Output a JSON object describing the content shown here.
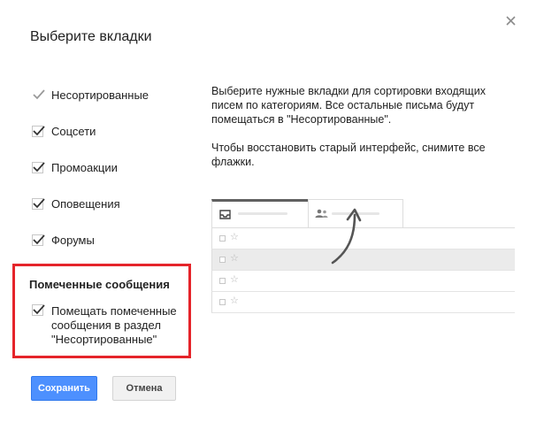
{
  "dialog": {
    "title": "Выберите вкладки",
    "close_icon": "close-icon"
  },
  "categories": [
    {
      "label": "Несортированные",
      "checked": true,
      "disabled": true
    },
    {
      "label": "Соцсети",
      "checked": true,
      "disabled": false
    },
    {
      "label": "Промоакции",
      "checked": true,
      "disabled": false
    },
    {
      "label": "Оповещения",
      "checked": true,
      "disabled": false
    },
    {
      "label": "Форумы",
      "checked": true,
      "disabled": false
    }
  ],
  "starred": {
    "title": "Помеченные сообщения",
    "option_label": "Помещать помеченные сообщения в раздел \"Несортированные\"",
    "checked": true,
    "highlight_color": "#e5242a"
  },
  "description": {
    "paragraph1": "Выберите нужные вкладки для сортировки входящих писем по категориям. Все остальные письма будут помещаться в \"Несортированные\".",
    "paragraph2": "Чтобы восстановить старый интерфейс, снимите все флажки."
  },
  "illustration": {
    "tabs": [
      {
        "icon": "inbox-icon"
      },
      {
        "icon": "people-icon"
      }
    ],
    "rows": 4,
    "star_glyph": "☆"
  },
  "buttons": {
    "save_label": "Сохранить",
    "cancel_label": "Отмена"
  },
  "colors": {
    "primary_button": "#4d90fe",
    "highlight_border": "#e5242a"
  }
}
